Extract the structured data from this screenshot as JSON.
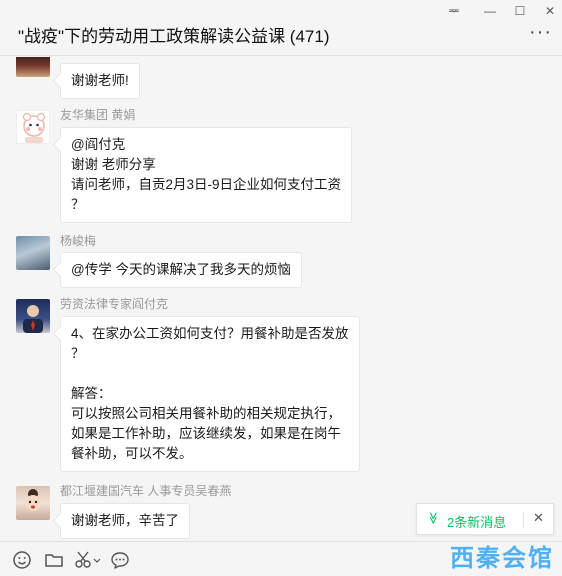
{
  "window": {
    "controls": {
      "pin": "ᆓ",
      "minimize": "—",
      "maximize": "☐",
      "close": "✕"
    }
  },
  "header": {
    "title": "\"战疫\"下的劳动用工政策解读公益课 (471)",
    "more": "···"
  },
  "messages": [
    {
      "sender": "",
      "lines": [
        "谢谢老师!"
      ]
    },
    {
      "sender": "友华集团 黄娟",
      "lines": [
        "@阎付克",
        "谢谢 老师分享",
        "请问老师，自贡2月3日-9日企业如何支付工资",
        "？"
      ]
    },
    {
      "sender": "杨峻梅",
      "lines": [
        "@传学 今天的课解决了我多天的烦恼"
      ]
    },
    {
      "sender": "劳资法律专家阎付克",
      "lines": [
        "4、在家办公工资如何支付？用餐补助是否发放",
        "？",
        "",
        "解答：",
        "可以按照公司相关用餐补助的相关规定执行，",
        "如果是工作补助，应该继续发，如果是在岗午",
        "餐补助，可以不发。"
      ]
    },
    {
      "sender": "都江堰建国汽车 人事专员吴春燕",
      "lines": [
        "谢谢老师，辛苦了"
      ]
    }
  ],
  "new_messages": {
    "label": "2条新消息",
    "chevron": "≫",
    "close": "✕"
  },
  "toolbar": {
    "icons": [
      "emoji-icon",
      "folder-icon",
      "scissors-icon",
      "chat-history-icon"
    ]
  },
  "watermark": "西秦会馆",
  "colors": {
    "accent": "#07c160",
    "watermark": "#3fa9f5"
  }
}
